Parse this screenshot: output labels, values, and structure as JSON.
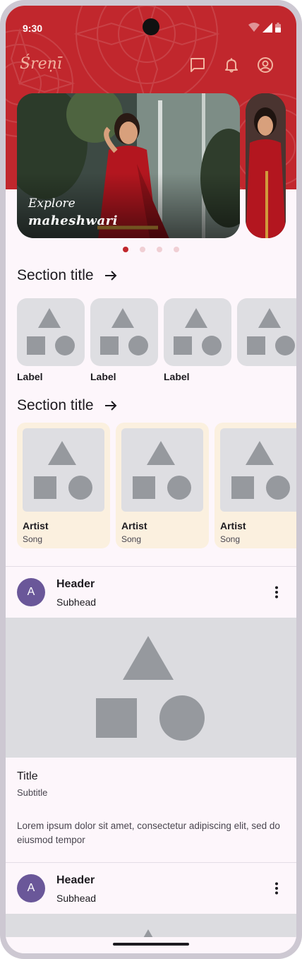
{
  "status_bar": {
    "time": "9:30"
  },
  "app_bar": {
    "brand": "Śreṇī"
  },
  "carousel": {
    "caption_line1": "Explore",
    "caption_line2": "maheshwari",
    "active_index": 0,
    "page_count": 4
  },
  "section1": {
    "title": "Section title",
    "items": [
      {
        "label": "Label"
      },
      {
        "label": "Label"
      },
      {
        "label": "Label"
      },
      {
        "label": ""
      }
    ]
  },
  "section2": {
    "title": "Section title",
    "items": [
      {
        "artist": "Artist",
        "song": "Song"
      },
      {
        "artist": "Artist",
        "song": "Song"
      },
      {
        "artist": "Artist",
        "song": "Song"
      }
    ]
  },
  "cards": [
    {
      "avatar_letter": "A",
      "header": "Header",
      "subhead": "Subhead",
      "title": "Title",
      "subtitle": "Subtitle",
      "text": "Lorem ipsum dolor sit amet, consectetur adipiscing elit, sed do eiusmod tempor"
    },
    {
      "avatar_letter": "A",
      "header": "Header",
      "subhead": "Subhead"
    }
  ],
  "icons": {
    "chat": "chat-bubble-icon",
    "notifications": "bell-icon",
    "account": "account-circle-icon",
    "arrow": "arrow-right-icon",
    "more": "more-vert-icon"
  },
  "colors": {
    "brand_red": "#c1272d",
    "avatar": "#6a5799",
    "album_card": "#fbf0df",
    "placeholder": "#dedee2"
  }
}
